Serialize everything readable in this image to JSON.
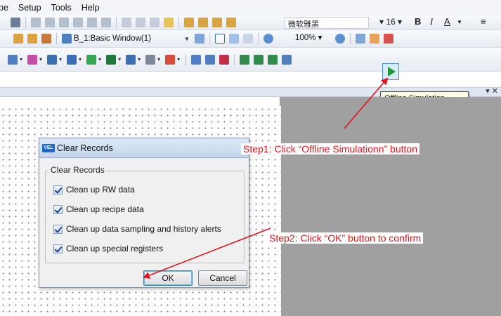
{
  "menubar": {
    "items": [
      "pe",
      "Setup",
      "Tools",
      "Help"
    ]
  },
  "toolbar1": {
    "font_name": "微软雅黑",
    "font_size": "16",
    "bold": "B",
    "italic": "I",
    "underline_color": "A"
  },
  "toolbar2": {
    "window_selector": "B_1:Basic Window(1)",
    "zoom": "100%"
  },
  "tooltip": {
    "text": "Offline Simulation"
  },
  "dialog": {
    "title": "Clear Records",
    "group_label": "Clear Records",
    "options": [
      {
        "label": "Clean up RW data",
        "checked": true
      },
      {
        "label": "Clean up recipe data",
        "checked": true
      },
      {
        "label": "Clean up data sampling and history alerts",
        "checked": true
      },
      {
        "label": "Clean up special registers",
        "checked": true
      }
    ],
    "ok_label": "OK",
    "cancel_label": "Cancel"
  },
  "annotations": {
    "step1": "Step1: Click “Offline Simulationn” button",
    "step2": "Step2: Click “OK” button to confirm"
  },
  "colors": {
    "annotation": "#e0161b",
    "play": "#1f9a35",
    "tooltip_bg": "#fdfde3"
  }
}
